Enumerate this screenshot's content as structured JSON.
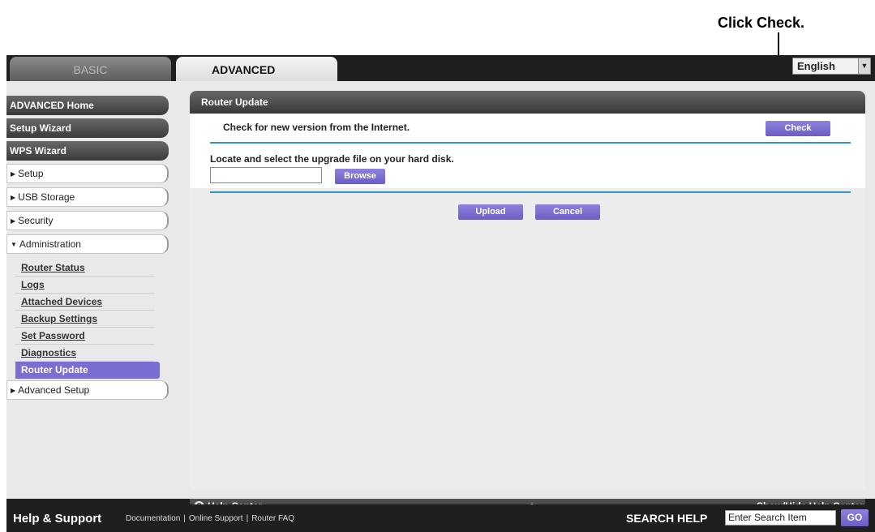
{
  "annotation": {
    "callout_text": "Click Check."
  },
  "tabs": {
    "basic": "BASIC",
    "advanced": "ADVANCED"
  },
  "language": {
    "selected": "English"
  },
  "sidebar": {
    "top_items": [
      "ADVANCED Home",
      "Setup Wizard",
      "WPS Wizard"
    ],
    "sections": [
      "Setup",
      "USB Storage",
      "Security"
    ],
    "administration": "Administration",
    "admin_items": [
      "Router Status",
      "Logs",
      "Attached Devices",
      "Backup Settings",
      "Set Password",
      "Diagnostics",
      "Router Update"
    ],
    "advanced_setup": "Advanced Setup"
  },
  "panel": {
    "title": "Router Update",
    "check_text": "Check for new version from the Internet.",
    "check_button": "Check",
    "locate_text": "Locate and select the upgrade file on your hard disk.",
    "browse_button": "Browse",
    "upload_button": "Upload",
    "cancel_button": "Cancel"
  },
  "helpbar": {
    "label": "Help Center",
    "toggle": "Show/Hide Help Center",
    "help_icon": "?"
  },
  "footer": {
    "title": "Help & Support",
    "links": [
      "Documentation",
      "Online Support",
      "Router FAQ"
    ],
    "search_label": "SEARCH HELP",
    "search_value": "Enter Search Item",
    "go_button": "GO"
  },
  "colors": {
    "accent_button": "#7b6ed1",
    "divider": "#2f95c9"
  }
}
